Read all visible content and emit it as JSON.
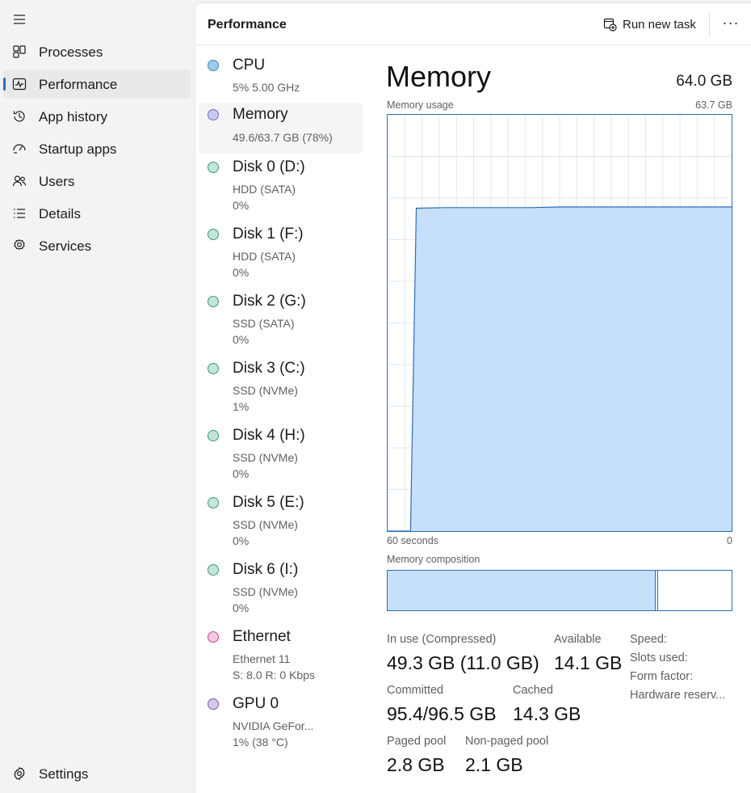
{
  "nav": {
    "items": [
      {
        "label": "Processes",
        "icon": "processes-icon"
      },
      {
        "label": "Performance",
        "icon": "performance-icon",
        "selected": true
      },
      {
        "label": "App history",
        "icon": "app-history-icon"
      },
      {
        "label": "Startup apps",
        "icon": "startup-apps-icon"
      },
      {
        "label": "Users",
        "icon": "users-icon"
      },
      {
        "label": "Details",
        "icon": "details-icon"
      },
      {
        "label": "Services",
        "icon": "services-icon"
      }
    ],
    "settings_label": "Settings"
  },
  "header": {
    "title": "Performance",
    "run_new_task": "Run new task",
    "more": "···"
  },
  "resources": [
    {
      "name": "CPU",
      "line1": "5% 5.00 GHz",
      "line2": "",
      "dot_fill": "#9ccbea",
      "dot_border": "#3a86c4"
    },
    {
      "name": "Memory",
      "line1": "49.6/63.7 GB (78%)",
      "line2": "",
      "dot_fill": "#c9c8f0",
      "dot_border": "#6f6fc8",
      "selected": true
    },
    {
      "name": "Disk 0 (D:)",
      "line1": "HDD (SATA)",
      "line2": "0%",
      "dot_fill": "#c4e5d8",
      "dot_border": "#3c9a7a"
    },
    {
      "name": "Disk 1 (F:)",
      "line1": "HDD (SATA)",
      "line2": "0%",
      "dot_fill": "#c4e5d8",
      "dot_border": "#3c9a7a"
    },
    {
      "name": "Disk 2 (G:)",
      "line1": "SSD (SATA)",
      "line2": "0%",
      "dot_fill": "#c4e5d8",
      "dot_border": "#3c9a7a"
    },
    {
      "name": "Disk 3 (C:)",
      "line1": "SSD (NVMe)",
      "line2": "1%",
      "dot_fill": "#c4e5d8",
      "dot_border": "#3c9a7a"
    },
    {
      "name": "Disk 4 (H:)",
      "line1": "SSD (NVMe)",
      "line2": "0%",
      "dot_fill": "#c4e5d8",
      "dot_border": "#3c9a7a"
    },
    {
      "name": "Disk 5 (E:)",
      "line1": "SSD (NVMe)",
      "line2": "0%",
      "dot_fill": "#c4e5d8",
      "dot_border": "#3c9a7a"
    },
    {
      "name": "Disk 6 (I:)",
      "line1": "SSD (NVMe)",
      "line2": "0%",
      "dot_fill": "#c4e5d8",
      "dot_border": "#3c9a7a"
    },
    {
      "name": "Ethernet",
      "line1": "Ethernet 11",
      "line2": "S: 8.0  R: 0 Kbps",
      "dot_fill": "#f7c6e0",
      "dot_border": "#c84a92"
    },
    {
      "name": "GPU 0",
      "line1": "NVIDIA GeFor...",
      "line2": "1% (38 °C)",
      "dot_fill": "#d6c8ea",
      "dot_border": "#7a5aae"
    }
  ],
  "detail": {
    "title": "Memory",
    "total": "64.0 GB",
    "usage_label": "Memory usage",
    "usage_max": "63.7 GB",
    "time_left": "60 seconds",
    "time_right": "0",
    "composition_label": "Memory composition",
    "composition": {
      "in_use_fraction": 0.779,
      "modified_fraction": 0.004
    },
    "stats": {
      "in_use_label": "In use (Compressed)",
      "in_use_value": "49.3 GB (11.0 GB)",
      "available_label": "Available",
      "available_value": "14.1 GB",
      "committed_label": "Committed",
      "committed_value": "95.4/96.5 GB",
      "cached_label": "Cached",
      "cached_value": "14.3 GB",
      "paged_label": "Paged pool",
      "paged_value": "2.8 GB",
      "nonpaged_label": "Non-paged pool",
      "nonpaged_value": "2.1 GB"
    },
    "specs": {
      "speed": "Speed:",
      "slots": "Slots used:",
      "form": "Form factor:",
      "hw_reserved": "Hardware reserv..."
    }
  },
  "chart_data": {
    "type": "area",
    "xlabel_left": "60 seconds",
    "xlabel_right": "0",
    "ylabel": "Memory usage",
    "ylim": [
      0,
      63.7
    ],
    "grid": true,
    "x": [
      60,
      56,
      55,
      50,
      45,
      40,
      35,
      30,
      25,
      20,
      15,
      10,
      5,
      0
    ],
    "values": [
      0,
      0,
      49.4,
      49.5,
      49.5,
      49.5,
      49.5,
      49.6,
      49.6,
      49.6,
      49.6,
      49.6,
      49.6,
      49.6
    ],
    "colors": {
      "fill": "#c6dffb",
      "line": "#2e6db4",
      "grid": "#e2e8f0"
    }
  }
}
